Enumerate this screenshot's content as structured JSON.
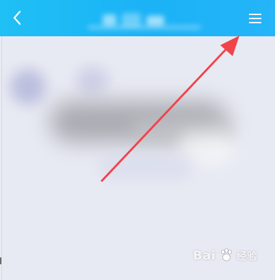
{
  "header": {
    "back_icon": "chevron-left-icon",
    "menu_icon": "hamburger-menu-icon",
    "title": "",
    "bg_color": "#1fb8f5"
  },
  "annotation": {
    "arrow_color": "#f2434a",
    "points_to": "menu-button"
  },
  "watermark": {
    "brand": "Bai",
    "paw_icon": "paw-icon",
    "suffix": "经验"
  }
}
